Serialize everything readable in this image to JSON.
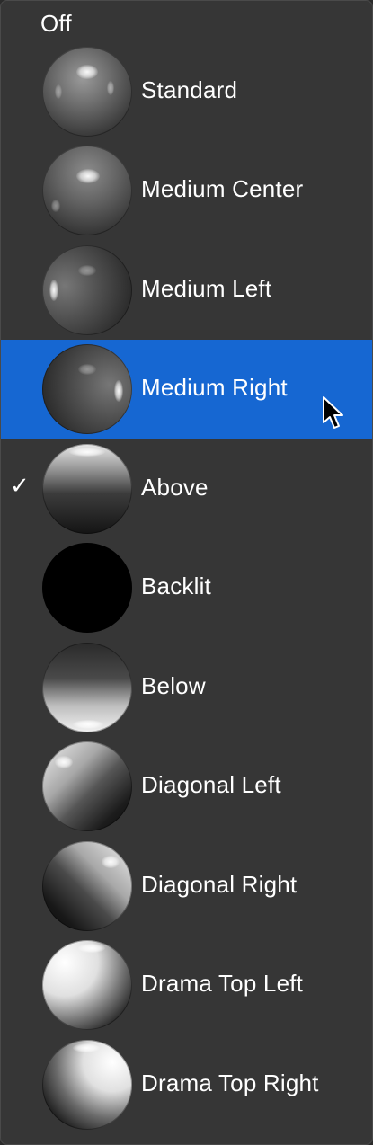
{
  "menu": {
    "off_label": "Off",
    "checkmark": "✓",
    "items": [
      {
        "label": "Standard",
        "icon": "sphere-standard-icon",
        "selected": false,
        "checked": false
      },
      {
        "label": "Medium Center",
        "icon": "sphere-medium-center-icon",
        "selected": false,
        "checked": false
      },
      {
        "label": "Medium Left",
        "icon": "sphere-medium-left-icon",
        "selected": false,
        "checked": false
      },
      {
        "label": "Medium Right",
        "icon": "sphere-medium-right-icon",
        "selected": true,
        "checked": false
      },
      {
        "label": "Above",
        "icon": "sphere-above-icon",
        "selected": false,
        "checked": true
      },
      {
        "label": "Backlit",
        "icon": "sphere-backlit-icon",
        "selected": false,
        "checked": false
      },
      {
        "label": "Below",
        "icon": "sphere-below-icon",
        "selected": false,
        "checked": false
      },
      {
        "label": "Diagonal Left",
        "icon": "sphere-diagonal-left-icon",
        "selected": false,
        "checked": false
      },
      {
        "label": "Diagonal Right",
        "icon": "sphere-diagonal-right-icon",
        "selected": false,
        "checked": false
      },
      {
        "label": "Drama Top Left",
        "icon": "sphere-drama-top-left-icon",
        "selected": false,
        "checked": false
      },
      {
        "label": "Drama Top Right",
        "icon": "sphere-drama-top-right-icon",
        "selected": false,
        "checked": false
      }
    ]
  },
  "colors": {
    "menu_background": "#363636",
    "highlight": "#1667d2",
    "text": "#ffffff"
  }
}
